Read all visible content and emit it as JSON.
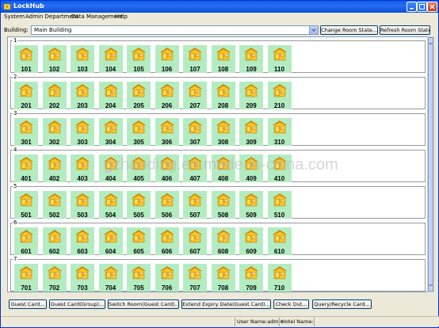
{
  "window": {
    "title": "LockHub"
  },
  "menu": [
    "System",
    "Admin Department",
    "Data Management",
    "Help"
  ],
  "building": {
    "label": "Building:",
    "selected": "Main Building",
    "change_button": "Change Room State...",
    "refresh_button": "Refresh Room State"
  },
  "floors": [
    {
      "label": "1",
      "rooms": [
        "101",
        "102",
        "103",
        "104",
        "105",
        "106",
        "107",
        "108",
        "109",
        "110"
      ]
    },
    {
      "label": "2",
      "rooms": [
        "201",
        "202",
        "203",
        "204",
        "205",
        "206",
        "207",
        "208",
        "209",
        "210"
      ]
    },
    {
      "label": "3",
      "rooms": [
        "301",
        "302",
        "303",
        "304",
        "305",
        "306",
        "307",
        "308",
        "309",
        "310"
      ]
    },
    {
      "label": "4",
      "rooms": [
        "401",
        "402",
        "403",
        "404",
        "405",
        "406",
        "407",
        "408",
        "409",
        "410"
      ]
    },
    {
      "label": "5",
      "rooms": [
        "501",
        "502",
        "503",
        "504",
        "505",
        "506",
        "507",
        "508",
        "509",
        "510"
      ]
    },
    {
      "label": "6",
      "rooms": [
        "601",
        "602",
        "603",
        "604",
        "605",
        "606",
        "607",
        "608",
        "609",
        "610"
      ]
    },
    {
      "label": "7",
      "rooms": [
        "701",
        "702",
        "703",
        "704",
        "705",
        "706",
        "707",
        "708",
        "709",
        "710"
      ]
    }
  ],
  "actions": [
    "Guest Card...",
    "Guest Card(Group)...",
    "Switch Room(Guest Card)...",
    "Extend Expiry Date(Guest Card)...",
    "Check Out...",
    "Query/Recycle Card..."
  ],
  "status": {
    "user": "User Name:admin",
    "hotel": "Hotel Name:"
  },
  "watermark": "gzhaoding.en.made-in-china.com",
  "colors": {
    "room_bg": "#b4ecc2",
    "titlebar": "#0a5fe8"
  }
}
